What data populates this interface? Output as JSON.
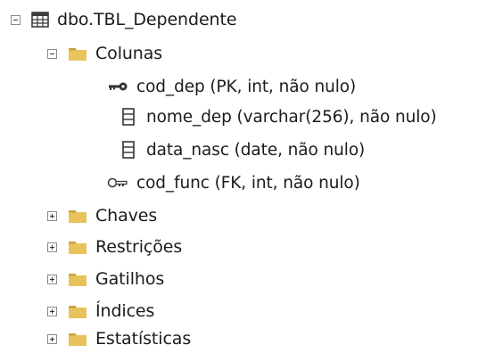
{
  "tree": {
    "table": {
      "label": "dbo.TBL_Dependente",
      "icon": "table-icon"
    },
    "columns_folder": {
      "label": "Colunas",
      "icon": "folder-icon"
    },
    "columns": [
      {
        "label": "cod_dep (PK, int, não nulo)",
        "icon": "primary-key-icon"
      },
      {
        "label": "nome_dep (varchar(256), não nulo)",
        "icon": "column-icon"
      },
      {
        "label": "data_nasc (date, não nulo)",
        "icon": "column-icon"
      },
      {
        "label": "cod_func (FK, int, não nulo)",
        "icon": "foreign-key-icon"
      }
    ],
    "folders": [
      {
        "label": "Chaves",
        "icon": "folder-icon"
      },
      {
        "label": "Restrições",
        "icon": "folder-icon"
      },
      {
        "label": "Gatilhos",
        "icon": "folder-icon"
      },
      {
        "label": "Índices",
        "icon": "folder-icon"
      },
      {
        "label": "Estatísticas",
        "icon": "folder-icon"
      }
    ]
  },
  "colors": {
    "folder": "#e8c25a",
    "folder_dark": "#c9a23a",
    "table_icon": "#3c3c3c"
  }
}
